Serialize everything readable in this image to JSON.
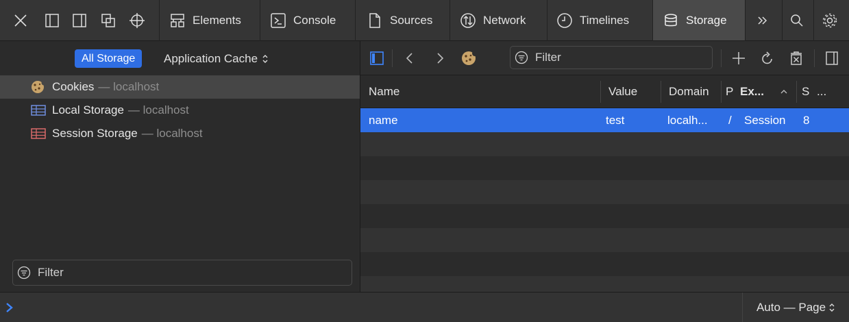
{
  "tabs": [
    {
      "label": "Elements",
      "icon": "elements-icon"
    },
    {
      "label": "Console",
      "icon": "console-icon"
    },
    {
      "label": "Sources",
      "icon": "sources-icon"
    },
    {
      "label": "Network",
      "icon": "network-icon"
    },
    {
      "label": "Timelines",
      "icon": "timelines-icon"
    },
    {
      "label": "Storage",
      "icon": "storage-icon",
      "active": true
    }
  ],
  "sidebar": {
    "scope": {
      "all_storage": "All Storage",
      "app_cache": "Application Cache"
    },
    "items": [
      {
        "label": "Cookies",
        "host": "— localhost",
        "icon": "cookie-icon",
        "selected": true
      },
      {
        "label": "Local Storage",
        "host": "— localhost",
        "icon": "local-storage-icon"
      },
      {
        "label": "Session Storage",
        "host": "— localhost",
        "icon": "session-storage-icon"
      }
    ],
    "filter_placeholder": "Filter"
  },
  "content": {
    "filter_placeholder": "Filter",
    "columns": [
      "Name",
      "Value",
      "Domain",
      "P",
      "Ex...",
      "S",
      "..."
    ],
    "rows": [
      {
        "name": "name",
        "value": "test",
        "domain": "localh...",
        "path": "/",
        "expires": "Session",
        "size": "8"
      }
    ]
  },
  "bottom": {
    "page_selector": "Auto — Page"
  },
  "colors": {
    "accent": "#2f6ee4",
    "background": "#2b2b2b",
    "toolbar": "#353535",
    "row_alt": "#333333"
  }
}
